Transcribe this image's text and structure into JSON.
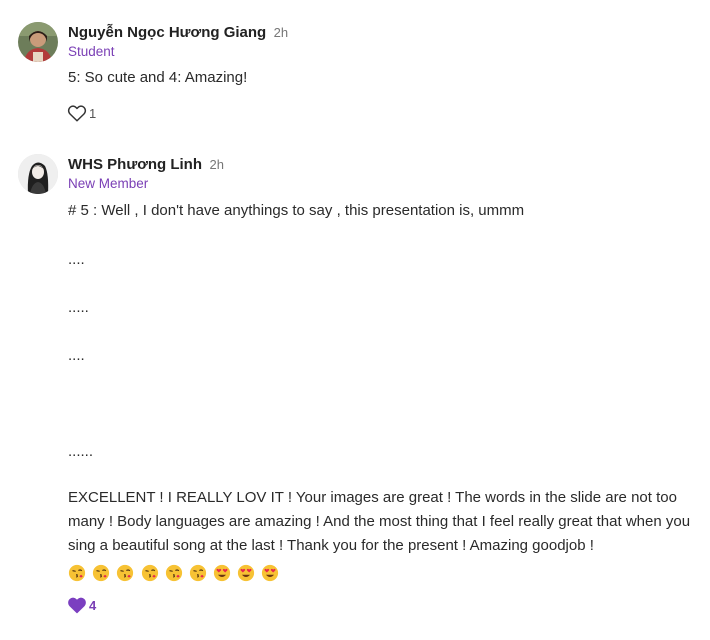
{
  "comments": [
    {
      "author": "Nguyễn Ngọc Hương Giang",
      "time": "2h",
      "role": "Student",
      "lines": [
        "5: So cute and 4: Amazing!"
      ],
      "likes": "1",
      "liked": false,
      "like_icon": "heart-outline-icon"
    },
    {
      "author": "WHS Phương Linh",
      "time": "2h",
      "role": "New Member",
      "lines": [
        "# 5 : Well , I don't have  anythings to say  , this presentation is, ummm",
        "....",
        ".....",
        "....",
        "......"
      ],
      "paragraph": "EXCELLENT ! I REALLY LOV IT ! Your images are great ! The words in the slide are not too many ! Body languages are amazing ! And the most thing that I feel really great that when you sing a beautiful song at the last ! Thank you for the present ! Amazing goodjob ! ",
      "emojis": [
        "face-blowing-kiss",
        "face-blowing-kiss",
        "face-blowing-kiss",
        "face-blowing-kiss",
        "face-blowing-kiss",
        "face-blowing-kiss",
        "heart-eyes",
        "heart-eyes",
        "heart-eyes"
      ],
      "likes": "4",
      "liked": true,
      "like_icon": "heart-filled-icon"
    }
  ],
  "colors": {
    "role": "#7a3fb5",
    "liked_heart": "#7b3fc0"
  }
}
